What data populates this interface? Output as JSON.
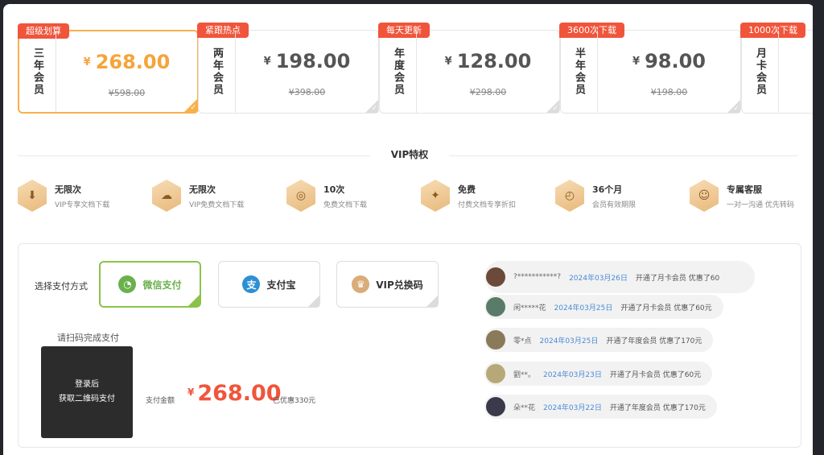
{
  "plans": [
    {
      "badge": "超级划算",
      "name": "三年会员",
      "yen": "¥",
      "price": "268.00",
      "original": "¥598.00"
    },
    {
      "badge": "紧跟热点",
      "name": "两年会员",
      "yen": "¥",
      "price": "198.00",
      "original": "¥398.00"
    },
    {
      "badge": "每天更新",
      "name": "年度会员",
      "yen": "¥",
      "price": "128.00",
      "original": "¥298.00"
    },
    {
      "badge": "3600次下载",
      "name": "半年会员",
      "yen": "¥",
      "price": "98.00",
      "original": "¥198.00"
    },
    {
      "badge": "1000次下载",
      "name": "月卡会员",
      "yen": "¥",
      "price": "",
      "original": ""
    }
  ],
  "vip": {
    "title": "VIP特权",
    "items": [
      {
        "title": "无限次",
        "desc": "VIP专享文档下载",
        "icon": "download-icon"
      },
      {
        "title": "无限次",
        "desc": "VIP免费文档下载",
        "icon": "cloud-download-icon"
      },
      {
        "title": "10次",
        "desc": "免费文档下载",
        "icon": "free-icon"
      },
      {
        "title": "免费",
        "desc": "付费文档专享折扣",
        "icon": "ticket-icon"
      },
      {
        "title": "36个月",
        "desc": "会员有效期限",
        "icon": "clock-icon"
      },
      {
        "title": "专属客服",
        "desc": "一对一沟通 优先转码",
        "icon": "headset-icon"
      }
    ]
  },
  "payment": {
    "label": "选择支付方式",
    "methods": [
      {
        "label": "微信支付",
        "icon": "wechat-icon",
        "color": "#6ab04c"
      },
      {
        "label": "支付宝",
        "icon": "alipay-icon",
        "color": "#2d8fd5"
      },
      {
        "label": "VIP兑换码",
        "icon": "crown-icon",
        "color": "#d9ac7a"
      }
    ],
    "scan_label": "请扫码完成支付",
    "qr_line1": "登录后",
    "qr_line2": "获取二维码支付",
    "amount_label": "支付金额",
    "amount_yen": "¥",
    "amount": "268.00",
    "discount": "已优惠330元"
  },
  "feed": [
    {
      "name": "?***********?",
      "date": "2024年03月26日",
      "text": "开通了月卡会员 优惠了60",
      "avatar_color": "#6b4a3a"
    },
    {
      "name": "闲*****花",
      "date": "2024年03月25日",
      "text": "开通了月卡会员 优惠了60元",
      "avatar_color": "#5a7a6a"
    },
    {
      "name": "零*点",
      "date": "2024年03月25日",
      "text": "开通了年度会员 优惠了170元",
      "avatar_color": "#8a7a5a"
    },
    {
      "name": "劉**。",
      "date": "2024年03月23日",
      "text": "开通了月卡会员 优惠了60元",
      "avatar_color": "#b8a878"
    },
    {
      "name": "朵**花",
      "date": "2024年03月22日",
      "text": "开通了年度会员 优惠了170元",
      "avatar_color": "#3a3a4a"
    }
  ]
}
